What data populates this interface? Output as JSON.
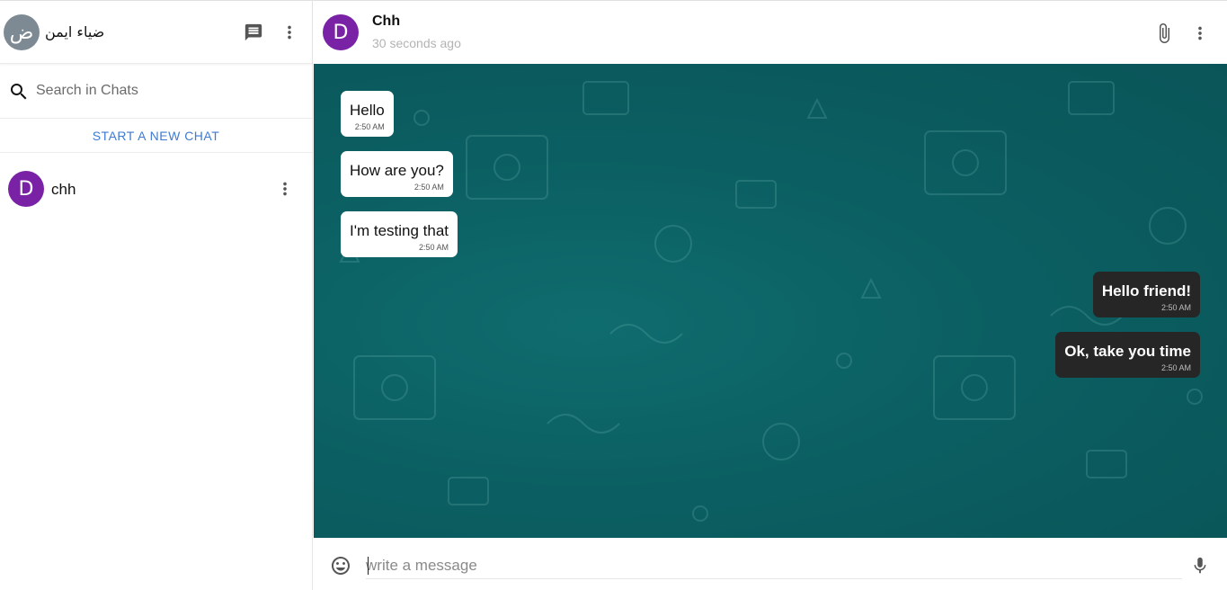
{
  "sidebar": {
    "me": {
      "avatar_letter": "ض",
      "name": "ضياء ايمن"
    },
    "icons": {
      "new_chat": "chat-icon",
      "menu": "more-vert-icon",
      "search": "search-icon"
    },
    "search": {
      "placeholder": "Search in Chats",
      "value": ""
    },
    "new_chat_label": "START A NEW CHAT",
    "chats": [
      {
        "avatar_letter": "D",
        "name": "chh"
      }
    ]
  },
  "conversation": {
    "header": {
      "avatar_letter": "D",
      "name": "Chh",
      "status": "30 seconds ago"
    },
    "messages": [
      {
        "direction": "in",
        "text": "Hello",
        "time": "2:50 AM"
      },
      {
        "direction": "in",
        "text": "How are you?",
        "time": "2:50 AM"
      },
      {
        "direction": "in",
        "text": "I'm testing that",
        "time": "2:50 AM"
      },
      {
        "direction": "out",
        "text": "Hello friend!",
        "time": "2:50 AM"
      },
      {
        "direction": "out",
        "text": "Ok, take you time",
        "time": "2:50 AM"
      }
    ],
    "composer": {
      "placeholder": "write a message",
      "value": ""
    }
  },
  "colors": {
    "accent_link": "#3f7bd0",
    "avatar_purple": "#7a22a6",
    "avatar_grey": "#7e8a93",
    "chat_background": "#0b5f62",
    "outgoing_bubble": "#262626",
    "incoming_bubble": "#ffffff"
  }
}
